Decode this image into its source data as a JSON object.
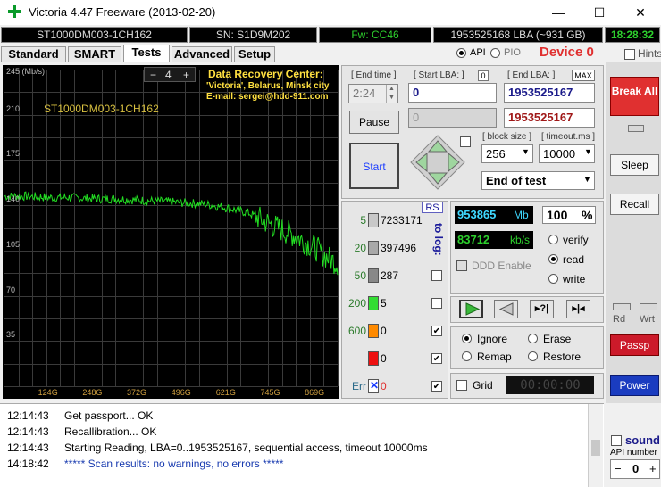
{
  "window": {
    "title": "Victoria 4.47  Freeware (2013-02-20)",
    "minimize": "—",
    "maximize": "☐",
    "close": "✕"
  },
  "info": {
    "model": "ST1000DM003-1CH162",
    "serial": "SN: S1D9M202",
    "firmware": "Fw: CC46",
    "lba": "1953525168 LBA (~931 GB)",
    "clock": "18:28:32"
  },
  "api": {
    "api_label": "API",
    "pio_label": "PIO",
    "device": "Device 0",
    "hints": "Hints"
  },
  "tabs": [
    "Standard",
    "SMART",
    "Tests",
    "Advanced",
    "Setup"
  ],
  "graph": {
    "unit": "245 (Mb/s)",
    "model_label": "ST1000DM003-1CH162",
    "spin_value": "4",
    "spin_minus": "−",
    "spin_plus": "+",
    "dr_title": "Data Recovery Center:",
    "dr_line1": "'Victoria', Belarus, Minsk city",
    "dr_line2": "E-mail: sergei@hdd-911.com",
    "y_ticks": [
      "210",
      "175",
      "140",
      "105",
      "70",
      "35"
    ],
    "x_ticks": [
      "124G",
      "248G",
      "372G",
      "496G",
      "621G",
      "745G",
      "869G"
    ]
  },
  "chart_data": {
    "type": "line",
    "title": "",
    "xlabel": "",
    "ylabel": "245 (Mb/s)",
    "ylim": [
      0,
      245
    ],
    "xlim": [
      0,
      931
    ],
    "x": [
      0,
      62,
      124,
      186,
      248,
      310,
      372,
      434,
      496,
      558,
      621,
      683,
      745,
      807,
      869,
      900,
      931
    ],
    "series": [
      {
        "values": [
          147,
          147,
          146,
          146,
          145,
          145,
          144,
          143,
          142,
          141,
          138,
          134,
          125,
          117,
          107,
          100,
          95
        ]
      }
    ]
  },
  "times": {
    "end_time_label": "[ End time ]",
    "end_time": "2:24",
    "start_lba_label": "[ Start LBA: ]",
    "start_lba_zero": "0",
    "start_lba": "0",
    "end_lba_label": "[ End LBA: ]",
    "max_label": "MAX",
    "end_lba": "1953525167",
    "end_lba_red": "1953525167",
    "cur_lba": "0"
  },
  "controls": {
    "pause": "Pause",
    "start": "Start",
    "block_size_label": "[ block size ]",
    "block_size": "256",
    "timeout_label": "[ timeout.ms ]",
    "timeout": "10000",
    "end_of_test": "End of test"
  },
  "stats": {
    "rs": "RS",
    "to_log": "to log:",
    "rows": [
      {
        "label": "5",
        "count": "7233171",
        "color": "#c8c8c8"
      },
      {
        "label": "20",
        "count": "397496",
        "color": "#a8a8a8"
      },
      {
        "label": "50",
        "count": "287",
        "color": "#888888"
      },
      {
        "label": "200",
        "count": "5",
        "color": "#33dd33"
      },
      {
        "label": "600",
        "count": "0",
        "color": "#ff8a00"
      },
      {
        "label": "",
        "count": "0",
        "color": "#ee1111"
      },
      {
        "label": "Err",
        "count": "0",
        "color": "#1a3cff"
      }
    ]
  },
  "speed": {
    "mb": "953865",
    "mb_unit": "Mb",
    "percent": "100",
    "percent_unit": "%",
    "kbs": "83712",
    "kbs_unit": "kb/s",
    "ddd": "DDD Enable"
  },
  "modes": {
    "verify": "verify",
    "read": "read",
    "write": "write"
  },
  "actions": {
    "ignore": "Ignore",
    "erase": "Erase",
    "remap": "Remap",
    "restore": "Restore",
    "grid": "Grid",
    "timer": "00:00:00"
  },
  "right": {
    "break": "Break All",
    "sleep": "Sleep",
    "recall": "Recall",
    "rd": "Rd",
    "wrt": "Wrt",
    "passp": "Passp",
    "power": "Power",
    "sound": "sound",
    "api_number": "API number",
    "api_value": "0"
  },
  "log": [
    {
      "time": "12:14:43",
      "msg": "Get passport... OK"
    },
    {
      "time": "12:14:43",
      "msg": "Recallibration... OK"
    },
    {
      "time": "12:14:43",
      "msg": "Starting Reading, LBA=0..1953525167, sequential access, timeout 10000ms"
    },
    {
      "time": "14:18:42",
      "msg": "***** Scan results: no warnings, no errors *****"
    }
  ],
  "colors": {
    "graph_line": "#22dd22",
    "accent_red": "#e03030",
    "power_blue": "#1a3cc0"
  }
}
